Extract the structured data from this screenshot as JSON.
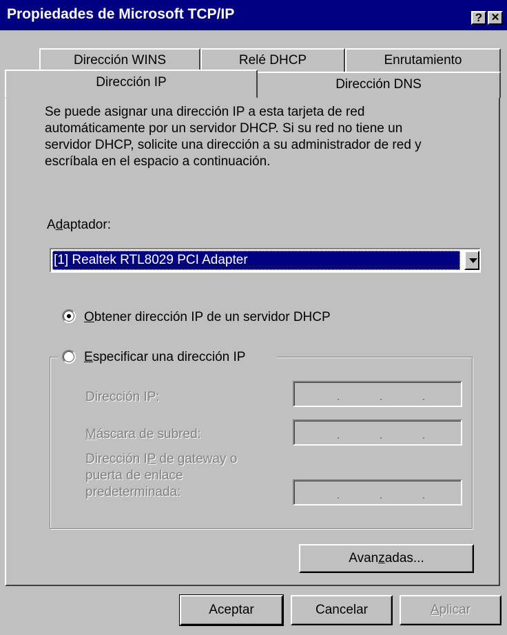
{
  "window": {
    "title": "Propiedades de Microsoft TCP/IP",
    "help_glyph": "?",
    "close_glyph": "✕"
  },
  "tabs": {
    "back_row": [
      "Dirección WINS",
      "Relé DHCP",
      "Enrutamiento"
    ],
    "front_row": [
      "Dirección IP",
      "Dirección DNS"
    ],
    "selected": "Dirección IP"
  },
  "content": {
    "description_lines": [
      "Se puede asignar una dirección IP a esta tarjeta de red",
      "automáticamente por un servidor DHCP. Si su red no tiene un",
      "servidor DHCP, solicite una dirección a su administrador de red y",
      "escríbala en el espacio a continuación."
    ],
    "adapter_label_pre": "A",
    "adapter_label_key": "d",
    "adapter_label_post": "aptador:",
    "adapter_value": "[1] Realtek RTL8029 PCI Adapter",
    "radio_dhcp": {
      "key": "O",
      "rest": "btener dirección IP de un servidor DHCP",
      "checked": true
    },
    "radio_static": {
      "key": "E",
      "rest": "specificar una dirección IP",
      "checked": false
    },
    "static": {
      "ip_label": "Dirección IP:",
      "mask_label_key": "M",
      "mask_label_rest": "áscara de subred:",
      "gateway_label_1_pre": "Dirección I",
      "gateway_label_1_key": "P",
      "gateway_label_1_post": " de gateway o",
      "gateway_label_2": "puerta de enlace",
      "gateway_label_3": "predeterminada:",
      "ip_sep": ".",
      "enabled": false
    },
    "advanced_pre": "Avan",
    "advanced_key": "z",
    "advanced_post": "adas..."
  },
  "footer": {
    "ok_label": "Aceptar",
    "cancel_label": "Cancelar",
    "apply_key": "A",
    "apply_rest": "plicar",
    "apply_enabled": false
  },
  "colors": {
    "titlebar": "#000080",
    "face": "#c0c0c0",
    "selection": "#000080",
    "disabled_text": "#808080"
  }
}
